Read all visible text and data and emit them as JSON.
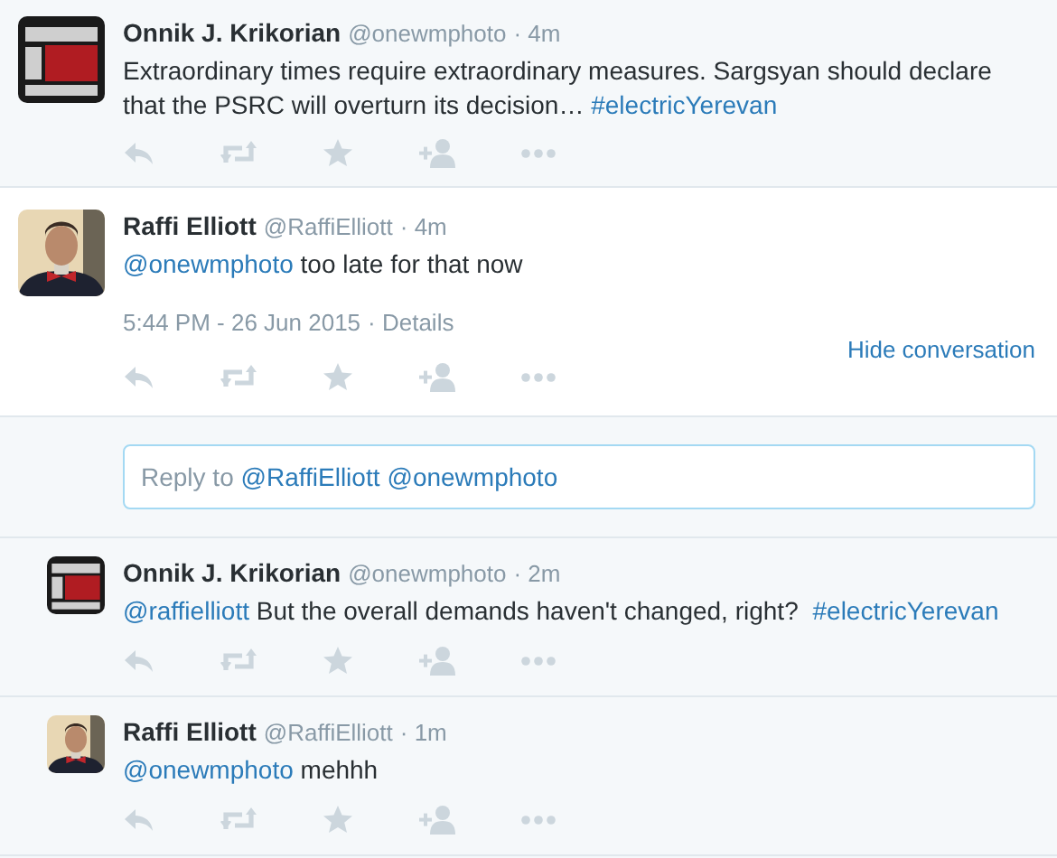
{
  "context_tweet": {
    "name": "Onnik J. Krikorian",
    "handle": "@onewmphoto",
    "time": "· 4m",
    "text": [
      {
        "kind": "text",
        "text": "Extraordinary times require extraordinary measures. Sargsyan should declare that the PSRC will overturn its decision… "
      },
      {
        "kind": "link",
        "text": "#electricYerevan"
      }
    ]
  },
  "focused_tweet": {
    "name": "Raffi Elliott",
    "handle": "@RaffiElliott",
    "time": "· 4m",
    "text": [
      {
        "kind": "link",
        "text": "@onewmphoto"
      },
      {
        "kind": "text",
        "text": " too late for that now"
      }
    ],
    "timestamp": "5:44 PM - 26 Jun 2015",
    "details": "· Details",
    "hide_label": "Hide conversation"
  },
  "reply_box": [
    {
      "kind": "text",
      "text": "Reply to "
    },
    {
      "kind": "link",
      "text": "@RaffiElliott"
    },
    {
      "kind": "link",
      "text": "@onewmphoto"
    }
  ],
  "replies": [
    {
      "name": "Onnik J. Krikorian",
      "handle": "@onewmphoto",
      "time": "· 2m",
      "text": [
        {
          "kind": "link",
          "text": "@raffielliott"
        },
        {
          "kind": "text",
          "text": " But the overall demands haven't changed, right? "
        },
        {
          "kind": "link",
          "text": "#electricYerevan"
        }
      ]
    },
    {
      "name": "Raffi Elliott",
      "handle": "@RaffiElliott",
      "time": "· 1m",
      "text": [
        {
          "kind": "link",
          "text": "@onewmphoto"
        },
        {
          "kind": "text",
          "text": " mehhh"
        }
      ]
    }
  ]
}
